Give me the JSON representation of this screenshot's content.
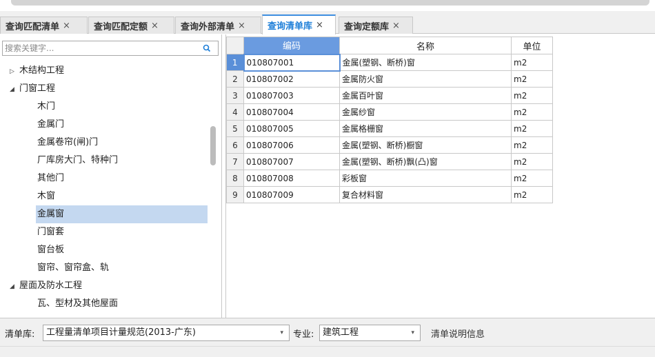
{
  "tabs": [
    {
      "label": "查询匹配清单",
      "close": "×"
    },
    {
      "label": "查询匹配定额",
      "close": "×"
    },
    {
      "label": "查询外部清单",
      "close": "×"
    },
    {
      "label": "查询清单库",
      "close": "×"
    },
    {
      "label": "查询定额库",
      "close": "×"
    }
  ],
  "search": {
    "placeholder": "搜索关键字..."
  },
  "tree": [
    {
      "arrow": "▷",
      "label": "木结构工程"
    },
    {
      "arrow": "◢",
      "label": "门窗工程"
    },
    {
      "arrow": "",
      "label": "木门"
    },
    {
      "arrow": "",
      "label": "金属门"
    },
    {
      "arrow": "",
      "label": "金属卷帘(闸)门"
    },
    {
      "arrow": "",
      "label": "厂库房大门、特种门"
    },
    {
      "arrow": "",
      "label": "其他门"
    },
    {
      "arrow": "",
      "label": "木窗"
    },
    {
      "arrow": "",
      "label": "金属窗"
    },
    {
      "arrow": "",
      "label": "门窗套"
    },
    {
      "arrow": "",
      "label": "窗台板"
    },
    {
      "arrow": "",
      "label": "窗帘、窗帘盒、轨"
    },
    {
      "arrow": "◢",
      "label": "屋面及防水工程"
    },
    {
      "arrow": "",
      "label": "瓦、型材及其他屋面"
    }
  ],
  "grid": {
    "headers": [
      "编码",
      "名称",
      "单位"
    ],
    "rows": [
      {
        "n": "1",
        "code": "010807001",
        "name": "金属(塑钢、断桥)窗",
        "unit": "m2"
      },
      {
        "n": "2",
        "code": "010807002",
        "name": "金属防火窗",
        "unit": "m2"
      },
      {
        "n": "3",
        "code": "010807003",
        "name": "金属百叶窗",
        "unit": "m2"
      },
      {
        "n": "4",
        "code": "010807004",
        "name": "金属纱窗",
        "unit": "m2"
      },
      {
        "n": "5",
        "code": "010807005",
        "name": "金属格栅窗",
        "unit": "m2"
      },
      {
        "n": "6",
        "code": "010807006",
        "name": "金属(塑钢、断桥)橱窗",
        "unit": "m2"
      },
      {
        "n": "7",
        "code": "010807007",
        "name": "金属(塑钢、断桥)飘(凸)窗",
        "unit": "m2"
      },
      {
        "n": "8",
        "code": "010807008",
        "name": "彩板窗",
        "unit": "m2"
      },
      {
        "n": "9",
        "code": "010807009",
        "name": "复合材料窗",
        "unit": "m2"
      }
    ]
  },
  "bottom": {
    "lib_label": "清单库:",
    "lib_value": "工程量清单项目计量规范(2013-广东)",
    "spec_label": "专业:",
    "spec_value": "建筑工程",
    "info_label": "清单说明信息",
    "dropdown_glyph": "▾"
  },
  "colors": {
    "accent": "#1e7fd8",
    "selected_row": "#c4d8f0",
    "header_highlight": "#6a9be0"
  }
}
